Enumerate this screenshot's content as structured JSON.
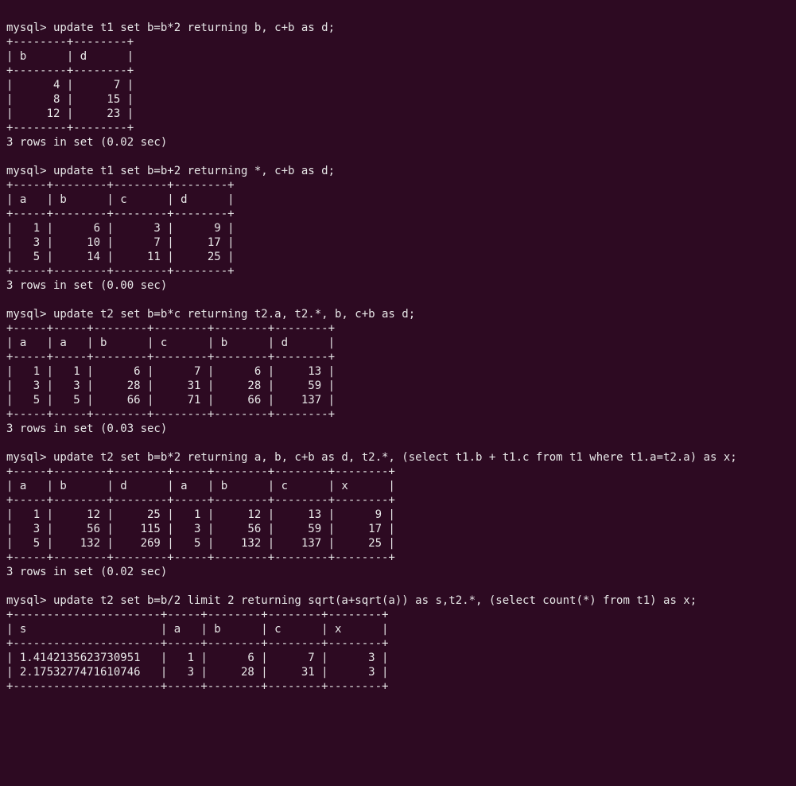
{
  "prompt": "mysql>",
  "blocks": [
    {
      "cmd": "update t1 set b=b*2 returning b, c+b as d;",
      "header": [
        "b",
        "d"
      ],
      "widths": [
        6,
        6
      ],
      "align": [
        "r",
        "r"
      ],
      "rows": [
        [
          "4",
          "7"
        ],
        [
          "8",
          "15"
        ],
        [
          "12",
          "23"
        ]
      ],
      "footer": "3 rows in set (0.02 sec)"
    },
    {
      "cmd": "update t1 set b=b+2 returning *, c+b as d;",
      "header": [
        "a",
        "b",
        "c",
        "d"
      ],
      "widths": [
        3,
        6,
        6,
        6
      ],
      "align": [
        "r",
        "r",
        "r",
        "r"
      ],
      "rows": [
        [
          "1",
          "6",
          "3",
          "9"
        ],
        [
          "3",
          "10",
          "7",
          "17"
        ],
        [
          "5",
          "14",
          "11",
          "25"
        ]
      ],
      "footer": "3 rows in set (0.00 sec)"
    },
    {
      "cmd": "update t2 set b=b*c returning t2.a, t2.*, b, c+b as d;",
      "header": [
        "a",
        "a",
        "b",
        "c",
        "b",
        "d"
      ],
      "widths": [
        3,
        3,
        6,
        6,
        6,
        6
      ],
      "align": [
        "r",
        "r",
        "r",
        "r",
        "r",
        "r"
      ],
      "rows": [
        [
          "1",
          "1",
          "6",
          "7",
          "6",
          "13"
        ],
        [
          "3",
          "3",
          "28",
          "31",
          "28",
          "59"
        ],
        [
          "5",
          "5",
          "66",
          "71",
          "66",
          "137"
        ]
      ],
      "footer": "3 rows in set (0.03 sec)"
    },
    {
      "cmd": "update t2 set b=b*2 returning a, b, c+b as d, t2.*, (select t1.b + t1.c from t1 where t1.a=t2.a) as x;",
      "header": [
        "a",
        "b",
        "d",
        "a",
        "b",
        "c",
        "x"
      ],
      "widths": [
        3,
        6,
        6,
        3,
        6,
        6,
        6
      ],
      "align": [
        "r",
        "r",
        "r",
        "r",
        "r",
        "r",
        "r"
      ],
      "rows": [
        [
          "1",
          "12",
          "25",
          "1",
          "12",
          "13",
          "9"
        ],
        [
          "3",
          "56",
          "115",
          "3",
          "56",
          "59",
          "17"
        ],
        [
          "5",
          "132",
          "269",
          "5",
          "132",
          "137",
          "25"
        ]
      ],
      "footer": "3 rows in set (0.02 sec)"
    },
    {
      "cmd": "update t2 set b=b/2 limit 2 returning sqrt(a+sqrt(a)) as s,t2.*, (select count(*) from t1) as x;",
      "header": [
        "s",
        "a",
        "b",
        "c",
        "x"
      ],
      "widths": [
        20,
        3,
        6,
        6,
        6
      ],
      "align": [
        "l",
        "r",
        "r",
        "r",
        "r"
      ],
      "rows": [
        [
          "1.4142135623730951",
          "1",
          "6",
          "7",
          "3"
        ],
        [
          "2.1753277471610746",
          "3",
          "28",
          "31",
          "3"
        ]
      ],
      "footer": null
    }
  ]
}
